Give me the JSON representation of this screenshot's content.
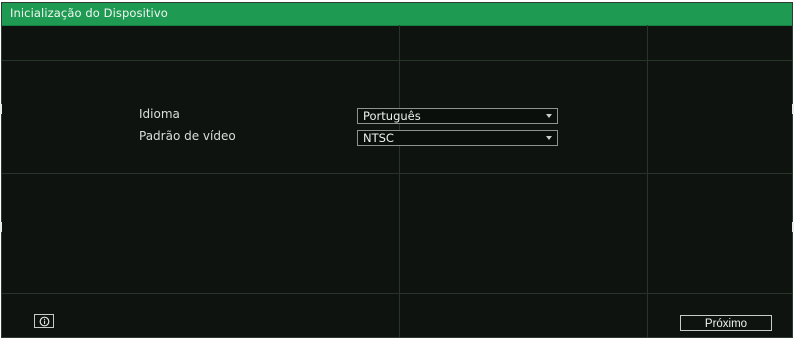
{
  "window": {
    "title": "Inicialização do Dispositivo"
  },
  "form": {
    "language": {
      "label": "Idioma",
      "value": "Português"
    },
    "video_standard": {
      "label": "Padrão de vídeo",
      "value": "NTSC"
    }
  },
  "footer": {
    "info_icon": "info-icon",
    "next_label": "Próximo"
  },
  "colors": {
    "titlebar": "#1e9a52",
    "background": "#0e130f",
    "gridline": "#283529",
    "text": "#eef2ee"
  }
}
